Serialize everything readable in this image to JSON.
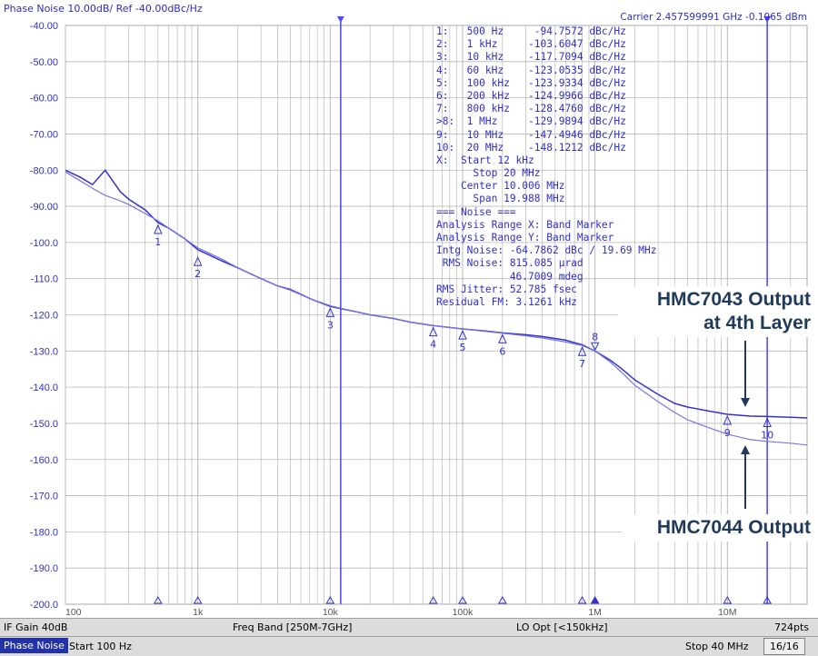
{
  "header": {
    "title": "Phase Noise 10.00dB/ Ref -40.00dBc/Hz",
    "carrier": "Carrier 2.457599991 GHz  -0.1965 dBm"
  },
  "marker_table": [
    "1:   500 Hz     -94.7572 dBc/Hz",
    "2:   1 kHz     -103.6047 dBc/Hz",
    "3:   10 kHz    -117.7094 dBc/Hz",
    "4:   60 kHz    -123.0535 dBc/Hz",
    "5:   100 kHz   -123.9334 dBc/Hz",
    "6:   200 kHz   -124.9966 dBc/Hz",
    "7:   800 kHz   -128.4760 dBc/Hz",
    ">8:  1 MHz     -129.9894 dBc/Hz",
    "9:   10 MHz    -147.4946 dBc/Hz",
    "10:  20 MHz    -148.1212 dBc/Hz",
    "X:  Start 12 kHz",
    "      Stop 20 MHz",
    "    Center 10.006 MHz",
    "      Span 19.988 MHz",
    "=== Noise ===",
    "Analysis Range X: Band Marker",
    "Analysis Range Y: Band Marker",
    "Intg Noise: -64.7862 dBc / 19.69 MHz",
    " RMS Noise: 815.085 μrad",
    "            46.7009 mdeg",
    "RMS Jitter: 52.785 fsec",
    "Residual FM: 3.1261 kHz"
  ],
  "annotations": {
    "hmc7043_line1": "HMC7043 Output",
    "hmc7043_line2": "at 4th Layer",
    "hmc7044": "HMC7044 Output"
  },
  "status": {
    "if_gain": "IF Gain 40dB",
    "freq_band": "Freq Band [250M-7GHz]",
    "lo_opt": "LO Opt [<150kHz]",
    "points": "724pts"
  },
  "bottom": {
    "tab": "Phase Noise",
    "start": "Start 100 Hz",
    "stop": "Stop 40 MHz",
    "page": "16/16"
  },
  "colors": {
    "grid": "#b8b8b8",
    "trace": "#3333cc",
    "trace_light": "#7777dd",
    "axis_text": "#3030c0",
    "band_marker": "#4d4dff"
  },
  "chart_data": {
    "type": "line",
    "title": "Phase Noise 10.00dB/ Ref -40.00dBc/Hz",
    "xscale": "log",
    "xlim": [
      100,
      40000000
    ],
    "ylim": [
      -200,
      -40
    ],
    "grid": true,
    "x_tick_labels": [
      {
        "x": 100,
        "label": "100"
      },
      {
        "x": 1000,
        "label": "1k"
      },
      {
        "x": 10000,
        "label": "10k"
      },
      {
        "x": 100000,
        "label": "100k"
      },
      {
        "x": 1000000,
        "label": "1M"
      },
      {
        "x": 10000000,
        "label": "10M"
      }
    ],
    "y_ticks": [
      -40,
      -50,
      -60,
      -70,
      -80,
      -90,
      -100,
      -110,
      -120,
      -130,
      -140,
      -150,
      -160,
      -170,
      -180,
      -190,
      -200
    ],
    "y_tick_labels": [
      "-40.00",
      "-50.00",
      "-60.00",
      "-70.00",
      "-80.00",
      "-90.00",
      "-100.0",
      "-110.0",
      "-120.0",
      "-130.0",
      "-140.0",
      "-150.0",
      "-160.0",
      "-170.0",
      "-180.0",
      "-190.0",
      "-200.0"
    ],
    "band_markers": [
      12000,
      20000000
    ],
    "series": [
      {
        "name": "HMC7043 Output at 4th Layer",
        "x": [
          100,
          130,
          160,
          200,
          260,
          300,
          400,
          500,
          600,
          800,
          1000,
          1500,
          2000,
          3000,
          4000,
          5000,
          7000,
          10000,
          15000,
          20000,
          30000,
          40000,
          60000,
          100000,
          150000,
          200000,
          300000,
          400000,
          600000,
          800000,
          1000000,
          1300000,
          1600000,
          2000000,
          3000000,
          4000000,
          5000000,
          7000000,
          10000000,
          15000000,
          20000000,
          30000000,
          40000000
        ],
        "y": [
          -80,
          -82,
          -84,
          -80,
          -86,
          -88,
          -91,
          -94.5,
          -96,
          -99,
          -102,
          -105,
          -107,
          -110,
          -112,
          -113,
          -115.5,
          -117.7,
          -119,
          -120,
          -121,
          -122,
          -123,
          -123.9,
          -124.5,
          -125,
          -125.5,
          -126,
          -127,
          -128.3,
          -130,
          -132.5,
          -135,
          -138,
          -142,
          -144.5,
          -145.5,
          -146.5,
          -147.5,
          -148,
          -148.1,
          -148.3,
          -148.5
        ]
      },
      {
        "name": "HMC7044 Output",
        "x": [
          100,
          130,
          160,
          200,
          260,
          300,
          400,
          500,
          600,
          800,
          1000,
          1500,
          2000,
          3000,
          4000,
          5000,
          7000,
          10000,
          15000,
          20000,
          30000,
          40000,
          60000,
          100000,
          150000,
          200000,
          300000,
          400000,
          600000,
          800000,
          1000000,
          1300000,
          1600000,
          2000000,
          3000000,
          4000000,
          5000000,
          7000000,
          10000000,
          15000000,
          20000000,
          30000000,
          40000000
        ],
        "y": [
          -80.5,
          -83,
          -85,
          -87,
          -88.5,
          -89.5,
          -92,
          -94,
          -96,
          -99,
          -101.5,
          -104.5,
          -107,
          -110,
          -112,
          -113.2,
          -115.5,
          -117.5,
          -119,
          -120,
          -121,
          -122,
          -123,
          -123.9,
          -124.6,
          -125.1,
          -125.8,
          -126.4,
          -127.5,
          -128.5,
          -130,
          -133,
          -136,
          -139.5,
          -144,
          -147,
          -149,
          -151,
          -153,
          -154.5,
          -155,
          -155.5,
          -156
        ]
      }
    ],
    "markers": [
      {
        "label": "1",
        "x": 500,
        "y": -94.7572
      },
      {
        "label": "2",
        "x": 1000,
        "y": -103.6047
      },
      {
        "label": "3",
        "x": 10000,
        "y": -117.7094
      },
      {
        "label": "4",
        "x": 60000,
        "y": -123.0535
      },
      {
        "label": "5",
        "x": 100000,
        "y": -123.9334
      },
      {
        "label": "6",
        "x": 200000,
        "y": -124.9966
      },
      {
        "label": "7",
        "x": 800000,
        "y": -128.476
      },
      {
        "label": "8",
        "x": 1000000,
        "y": -129.9894
      },
      {
        "label": "9",
        "x": 10000000,
        "y": -147.4946
      },
      {
        "label": "10",
        "x": 20000000,
        "y": -148.1212
      }
    ]
  }
}
